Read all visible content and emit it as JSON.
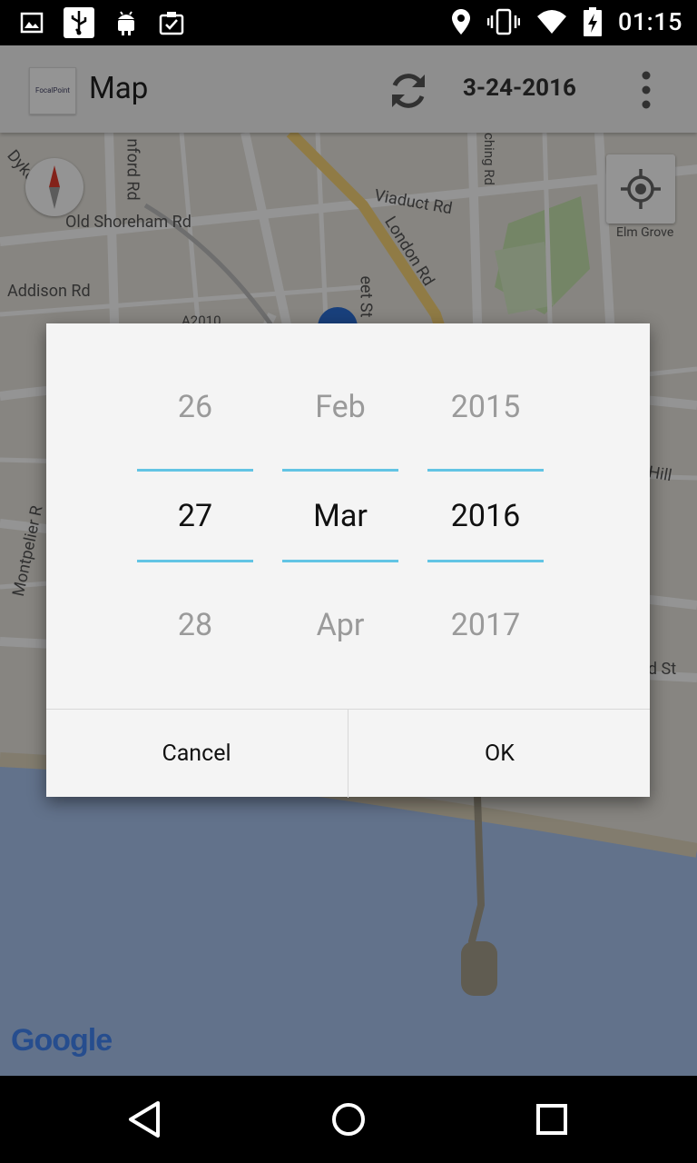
{
  "status_bar": {
    "time": "01:15",
    "left_icons": [
      "image-icon",
      "usb-icon",
      "android-icon",
      "clipboard-check-icon"
    ],
    "right_icons": [
      "location-icon",
      "vibrate-icon",
      "wifi-icon",
      "battery-charging-icon"
    ]
  },
  "app_bar": {
    "logo_text": "FocalPoint",
    "title": "Map",
    "date": "3-24-2016"
  },
  "map": {
    "labels": {
      "dyke_rd": "Dyke Rd",
      "old_shoreham_rd": "Old Shoreham Rd",
      "addison_rd": "Addison Rd",
      "viaduct_rd": "Viaduct Rd",
      "london_rd": "London Rd",
      "elm_grove": "Elm Grove",
      "nford_rd": "nford Rd",
      "ching_rd": "ching Rd",
      "montpelier": "Montpelier R",
      "a2010": "A2010",
      "eet_st": "eet St",
      "hill": "n Hill",
      "rd_st": "rd St"
    },
    "attribution": "Google"
  },
  "date_picker": {
    "day": {
      "prev": "26",
      "current": "27",
      "next": "28"
    },
    "month": {
      "prev": "Feb",
      "current": "Mar",
      "next": "Apr"
    },
    "year": {
      "prev": "2015",
      "current": "2016",
      "next": "2017"
    },
    "cancel_label": "Cancel",
    "ok_label": "OK"
  },
  "colors": {
    "accent_divider": "#62c4e4",
    "sea": "#a9c5f0",
    "park": "#c8e6b0"
  }
}
